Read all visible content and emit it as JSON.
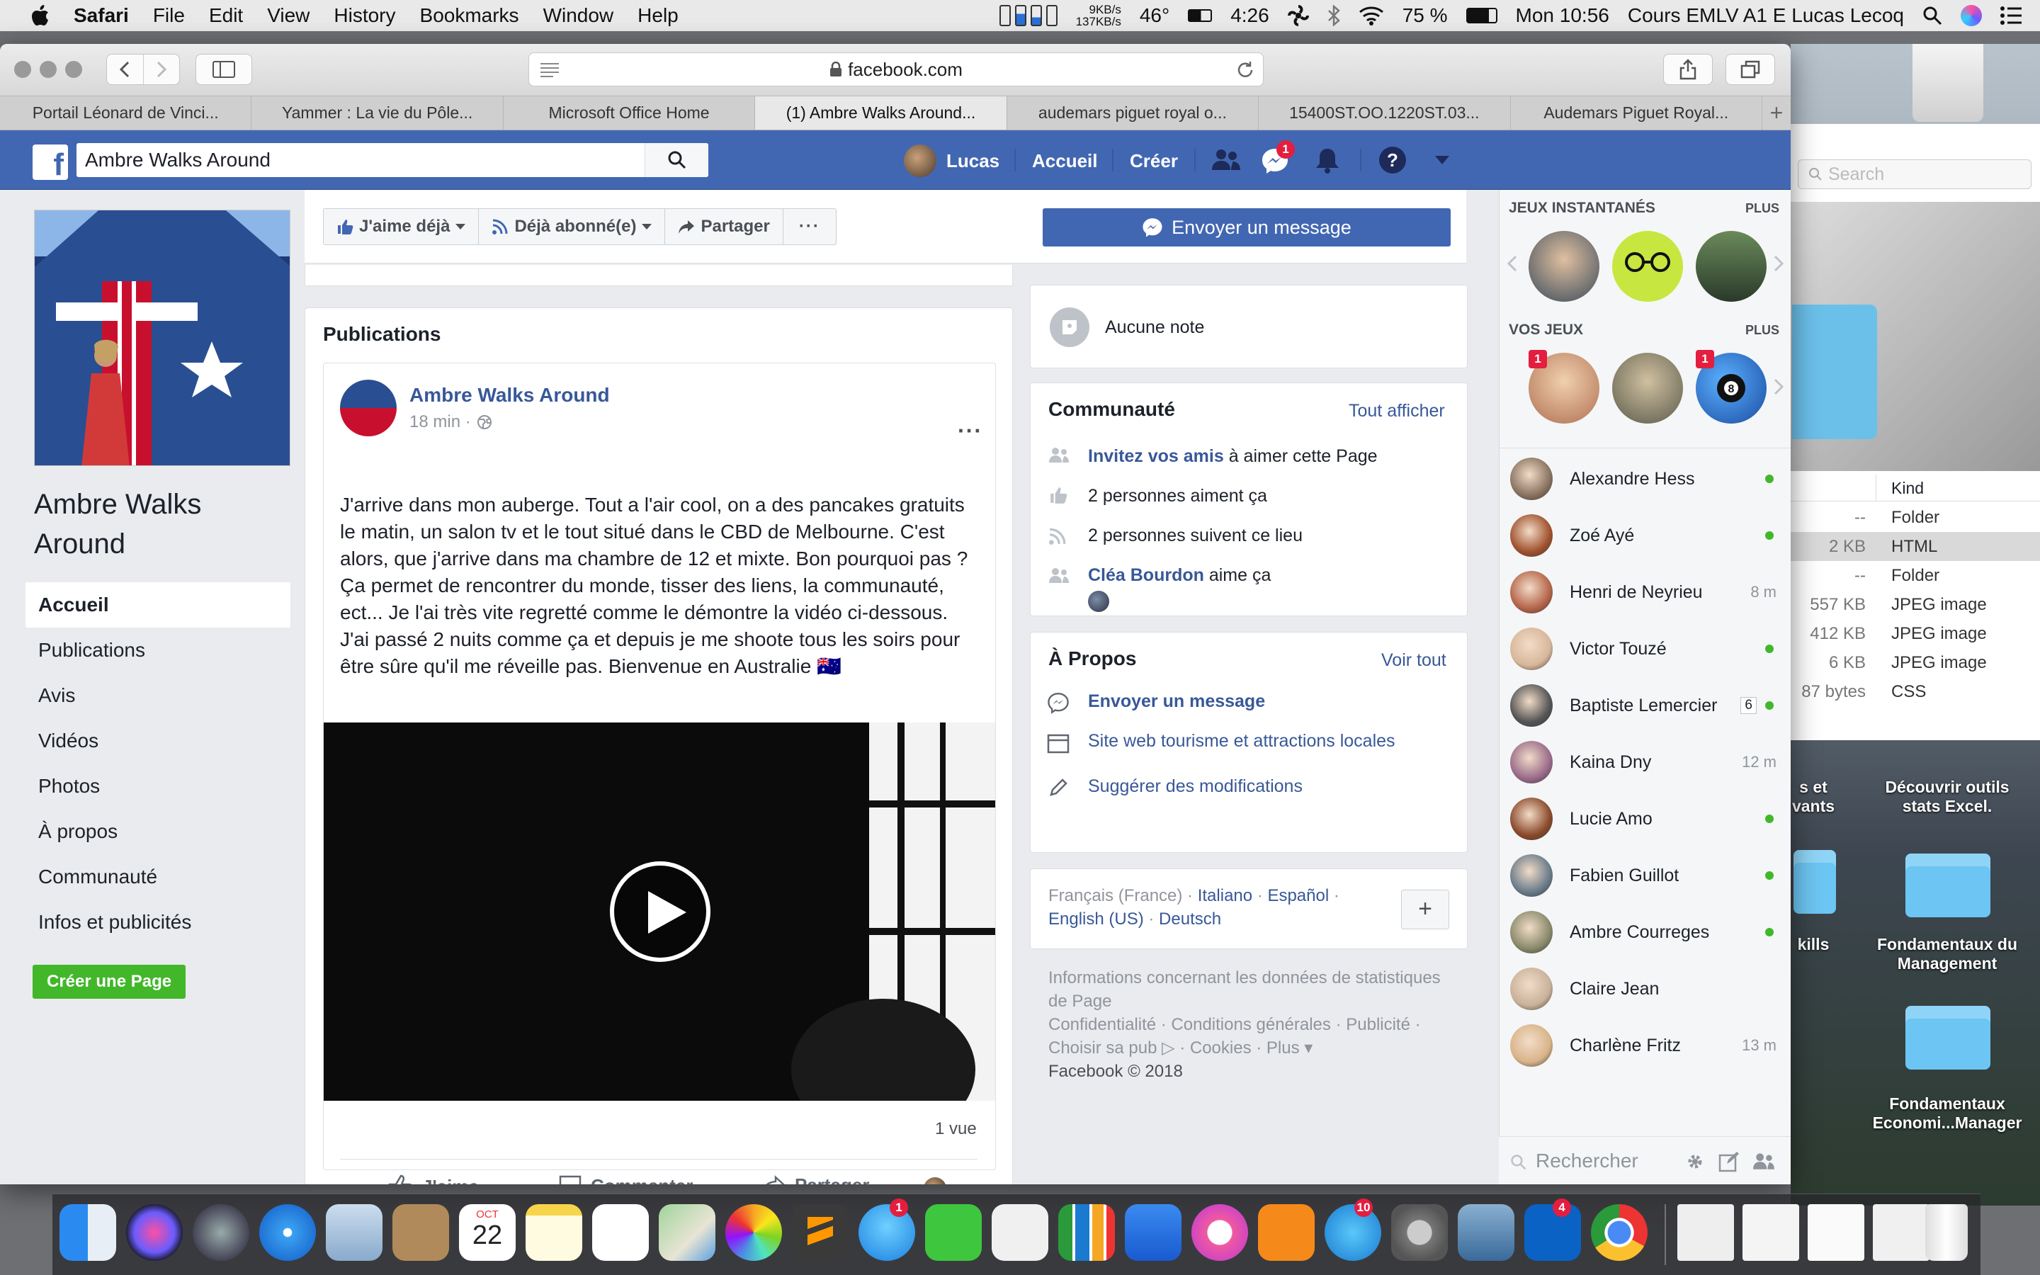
{
  "menubar": {
    "app": "Safari",
    "items": [
      "File",
      "Edit",
      "View",
      "History",
      "Bookmarks",
      "Window",
      "Help"
    ],
    "net_up": "9KB/s",
    "net_down": "137KB/s",
    "temp": "46°",
    "battery_time": "4:26",
    "wifi_pct": "75 %",
    "clock": "Mon 10:56",
    "user": "Cours EMLV A1 E Lucas Lecoq"
  },
  "browser": {
    "url": "facebook.com",
    "tabs": [
      {
        "label": "Portail Léonard de Vinci..."
      },
      {
        "label": "Yammer : La vie du Pôle..."
      },
      {
        "label": "Microsoft Office Home"
      },
      {
        "label": "(1) Ambre Walks Around..."
      },
      {
        "label": "audemars piguet royal o..."
      },
      {
        "label": "15400ST.OO.1220ST.03..."
      },
      {
        "label": "Audemars Piguet Royal..."
      }
    ],
    "new_tab": "+"
  },
  "fb": {
    "search_value": "Ambre Walks Around",
    "user_name": "Lucas",
    "nav_home": "Accueil",
    "nav_create": "Créer",
    "messenger_badge": "1",
    "page": {
      "name": "Ambre Walks Around",
      "nav": [
        "Accueil",
        "Publications",
        "Avis",
        "Vidéos",
        "Photos",
        "À propos",
        "Communauté",
        "Infos et publicités"
      ],
      "create_page": "Créer une Page",
      "btn_like": "J'aime déjà",
      "btn_follow": "Déjà abonné(e)",
      "btn_share": "Partager",
      "btn_more": "···",
      "btn_message": "Envoyer un message"
    },
    "feed": {
      "heading": "Publications",
      "post": {
        "author": "Ambre Walks Around",
        "time": "18 min ·",
        "more": "···",
        "text": "J'arrive dans mon auberge. Tout a l'air cool, on a des pancakes gratuits le matin, un salon tv et le tout situé dans le CBD de Melbourne. C'est alors, que j'arrive dans ma chambre de 12 et mixte. Bon pourquoi pas ? Ça permet de rencontrer du monde, tisser des liens, la communauté, ect... Je l'ai très vite regretté comme le démontre la vidéo ci-dessous. J'ai passé 2 nuits comme ça et depuis je me shoote tous les soirs pour être sûre qu'il me réveille pas. Bienvenue en Australie 🇦🇺",
        "views": "1 vue",
        "action_like": "J'aime",
        "action_comment": "Commenter",
        "action_share": "Partager"
      }
    },
    "side": {
      "notes": "Aucune note",
      "community_title": "Communauté",
      "community_all": "Tout afficher",
      "invite_link": "Invitez vos amis",
      "invite_rest": " à aimer cette Page",
      "likes": "2 personnes aiment ça",
      "follows": "2 personnes suivent ce lieu",
      "friend_like_name": "Cléa Bourdon",
      "friend_like_rest": " aime ça",
      "about_title": "À Propos",
      "about_all": "Voir tout",
      "about_msg": "Envoyer un message",
      "about_cat": "Site web tourisme et attractions locales",
      "about_suggest": "Suggérer des modifications",
      "lang_current": "Français (France) ·",
      "lang_it": "Italiano",
      "lang_es": "Español",
      "lang_en": "English (US)",
      "lang_de": "Deutsch",
      "lang_plus": "+",
      "footer1": "Informations concernant les données de statistiques de Page",
      "footer2": "Confidentialité · Conditions générales · Publicité · Choisir sa pub ▷ · Cookies · Plus ▾",
      "footer3": "Facebook © 2018"
    },
    "chat": {
      "games_title": "JEUX INSTANTANÉS",
      "games_more": "PLUS",
      "my_games_title": "VOS JEUX",
      "my_games_more": "PLUS",
      "game_badge": "1",
      "search_placeholder": "Rechercher",
      "friends": [
        {
          "name": "Alexandre Hess",
          "status": "",
          "color": "#8a7360"
        },
        {
          "name": "Zoé Ayé",
          "status": "",
          "color": "#a0522d"
        },
        {
          "name": "Henri de Neyrieu",
          "status": "8 m",
          "color": "#b5654a"
        },
        {
          "name": "Victor Touzé",
          "status": "",
          "color": "#d8b79a"
        },
        {
          "name": "Baptiste Lemercier",
          "status": "6",
          "color": "#555555"
        },
        {
          "name": "Kaina Dny",
          "status": "12 m",
          "color": "#9a6b8a"
        },
        {
          "name": "Lucie Amo",
          "status": "",
          "color": "#8b4a2b"
        },
        {
          "name": "Fabien Guillot",
          "status": "",
          "color": "#6b7c8a"
        },
        {
          "name": "Ambre Courreges",
          "status": "",
          "color": "#8a8a6b"
        },
        {
          "name": "Claire Jean",
          "status": "",
          "color": "#c9b29a"
        },
        {
          "name": "Charlène Fritz",
          "status": "13 m",
          "color": "#d9b48a"
        }
      ]
    }
  },
  "finder": {
    "search_placeholder": "Search",
    "col_kind": "Kind",
    "rows": [
      {
        "size": "--",
        "kind": "Folder"
      },
      {
        "size": "2 KB",
        "kind": "HTML"
      },
      {
        "size": "--",
        "kind": "Folder"
      },
      {
        "size": "557 KB",
        "kind": "JPEG image"
      },
      {
        "size": "412 KB",
        "kind": "JPEG image"
      },
      {
        "size": "6 KB",
        "kind": "JPEG image"
      },
      {
        "size": "87 bytes",
        "kind": "CSS"
      }
    ]
  },
  "desktop": {
    "label_a": "s et\nvants",
    "label_b": "Découvrir outils\nstats Excel.",
    "label_c": "kills",
    "label_d": "Fondamentaux du\nManagement",
    "label_e": "Fondamentaux\nEconomi...Manager"
  },
  "dock": {
    "calendar_month": "OCT",
    "calendar_day": "22",
    "badge_messages": "1",
    "badge_appstore": "10",
    "badge_outlook": "4"
  },
  "colors": {
    "fb_blue": "#4267b2",
    "link": "#385898",
    "green": "#42b72a",
    "create_page_green": "#42b72a"
  }
}
